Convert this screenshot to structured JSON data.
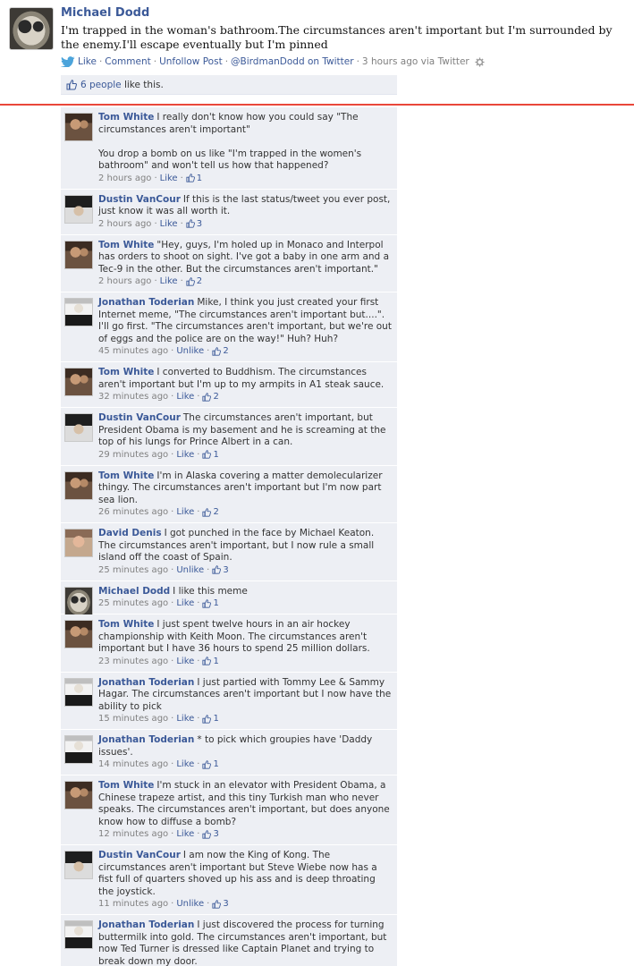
{
  "post": {
    "author": "Michael Dodd",
    "status": "I'm trapped in the woman's bathroom.The circumstances aren't important but I'm surrounded by the enemy.I'll escape eventually but I'm pinned",
    "actions": {
      "like": "Like",
      "comment": "Comment",
      "unfollow": "Unfollow Post",
      "source": "@BirdmanDodd on Twitter",
      "time": "3 hours ago via Twitter"
    },
    "likes_people": "6 people",
    "likes_suffix": "like this."
  },
  "colors": {
    "link": "#3b5998",
    "comment_bg": "#edeff4",
    "divider": "#e9473a",
    "meta": "#808080"
  },
  "icons": {
    "source": "twitter-bird-icon",
    "settings": "gear-icon",
    "like": "thumbs-up-icon"
  },
  "comments": [
    {
      "name": "Tom White",
      "text": "I really don't know how you could say \"The circumstances aren't important\"\n\nYou drop a bomb on us like \"I'm trapped in the women's bathroom\" and won't tell us how that happened?",
      "time": "2 hours ago",
      "action": "Like",
      "likes": "1",
      "avatar": "tom"
    },
    {
      "name": "Dustin VanCour",
      "text": "If this is the last status/tweet you ever post, just know it was all worth it.",
      "time": "2 hours ago",
      "action": "Like",
      "likes": "3",
      "avatar": "dustin"
    },
    {
      "name": "Tom White",
      "text": "\"Hey, guys, I'm holed up in Monaco and Interpol has orders to shoot on sight. I've got a baby in one arm and a Tec-9 in the other. But the circumstances aren't important.\"",
      "time": "2 hours ago",
      "action": "Like",
      "likes": "2",
      "avatar": "tom"
    },
    {
      "name": "Jonathan Toderian",
      "text": "Mike, I think you just created your first Internet meme, \"The circumstances aren't important but....\". I'll go first. \"The circumstances aren't important, but we're out of eggs and the police are on the way!\" Huh? Huh?",
      "time": "45 minutes ago",
      "action": "Unlike",
      "likes": "2",
      "avatar": "jonathan"
    },
    {
      "name": "Tom White",
      "text": "I converted to Buddhism. The circumstances aren't important but I'm up to my armpits in A1 steak sauce.",
      "time": "32 minutes ago",
      "action": "Like",
      "likes": "2",
      "avatar": "tom"
    },
    {
      "name": "Dustin VanCour",
      "text": "The circumstances aren't important, but President Obama is my basement and he is screaming at the top of his lungs for Prince Albert in a can.",
      "time": "29 minutes ago",
      "action": "Like",
      "likes": "1",
      "avatar": "dustin"
    },
    {
      "name": "Tom White",
      "text": "I'm in Alaska covering a matter demolecularizer thingy. The circumstances aren't important but I'm now part sea lion.",
      "time": "26 minutes ago",
      "action": "Like",
      "likes": "2",
      "avatar": "tom"
    },
    {
      "name": "David Denis",
      "text": "I got punched in the face by Michael Keaton. The circumstances aren't important, but I now rule a small island off the coast of Spain.",
      "time": "25 minutes ago",
      "action": "Unlike",
      "likes": "3",
      "avatar": "david"
    },
    {
      "name": "Michael Dodd",
      "text": "I like this meme",
      "time": "25 minutes ago",
      "action": "Like",
      "likes": "1",
      "avatar": "michael"
    },
    {
      "name": "Tom White",
      "text": "I just spent twelve hours in an air hockey championship with Keith Moon. The circumstances aren't important but I have 36 hours to spend 25 million dollars.",
      "time": "23 minutes ago",
      "action": "Like",
      "likes": "1",
      "avatar": "tom"
    },
    {
      "name": "Jonathan Toderian",
      "text": "I just partied with Tommy Lee & Sammy Hagar. The circumstances aren't important but I now have the ability to pick",
      "time": "15 minutes ago",
      "action": "Like",
      "likes": "1",
      "avatar": "jonathan"
    },
    {
      "name": "Jonathan Toderian",
      "text": "* to pick which groupies have 'Daddy issues'.",
      "time": "14 minutes ago",
      "action": "Like",
      "likes": "1",
      "avatar": "jonathan"
    },
    {
      "name": "Tom White",
      "text": "I'm stuck in an elevator with President Obama, a Chinese trapeze artist, and this tiny Turkish man who never speaks. The circumstances aren't important, but does anyone know how to diffuse a bomb?",
      "time": "12 minutes ago",
      "action": "Like",
      "likes": "3",
      "avatar": "tom"
    },
    {
      "name": "Dustin VanCour",
      "text": "I am now the King of Kong. The circumstances aren't important but Steve Wiebe now has a fist full of quarters shoved up his ass and is deep throating the joystick.",
      "time": "11 minutes ago",
      "action": "Unlike",
      "likes": "3",
      "avatar": "dustin"
    },
    {
      "name": "Jonathan Toderian",
      "text": "I just discovered the process for turning buttermilk into gold. The circumstances aren't important, but now Ted Turner is dressed like Captain Planet and trying to break down my door.",
      "time": "3 minutes ago",
      "action": "Like",
      "likes": "",
      "avatar": "jonathan"
    }
  ]
}
